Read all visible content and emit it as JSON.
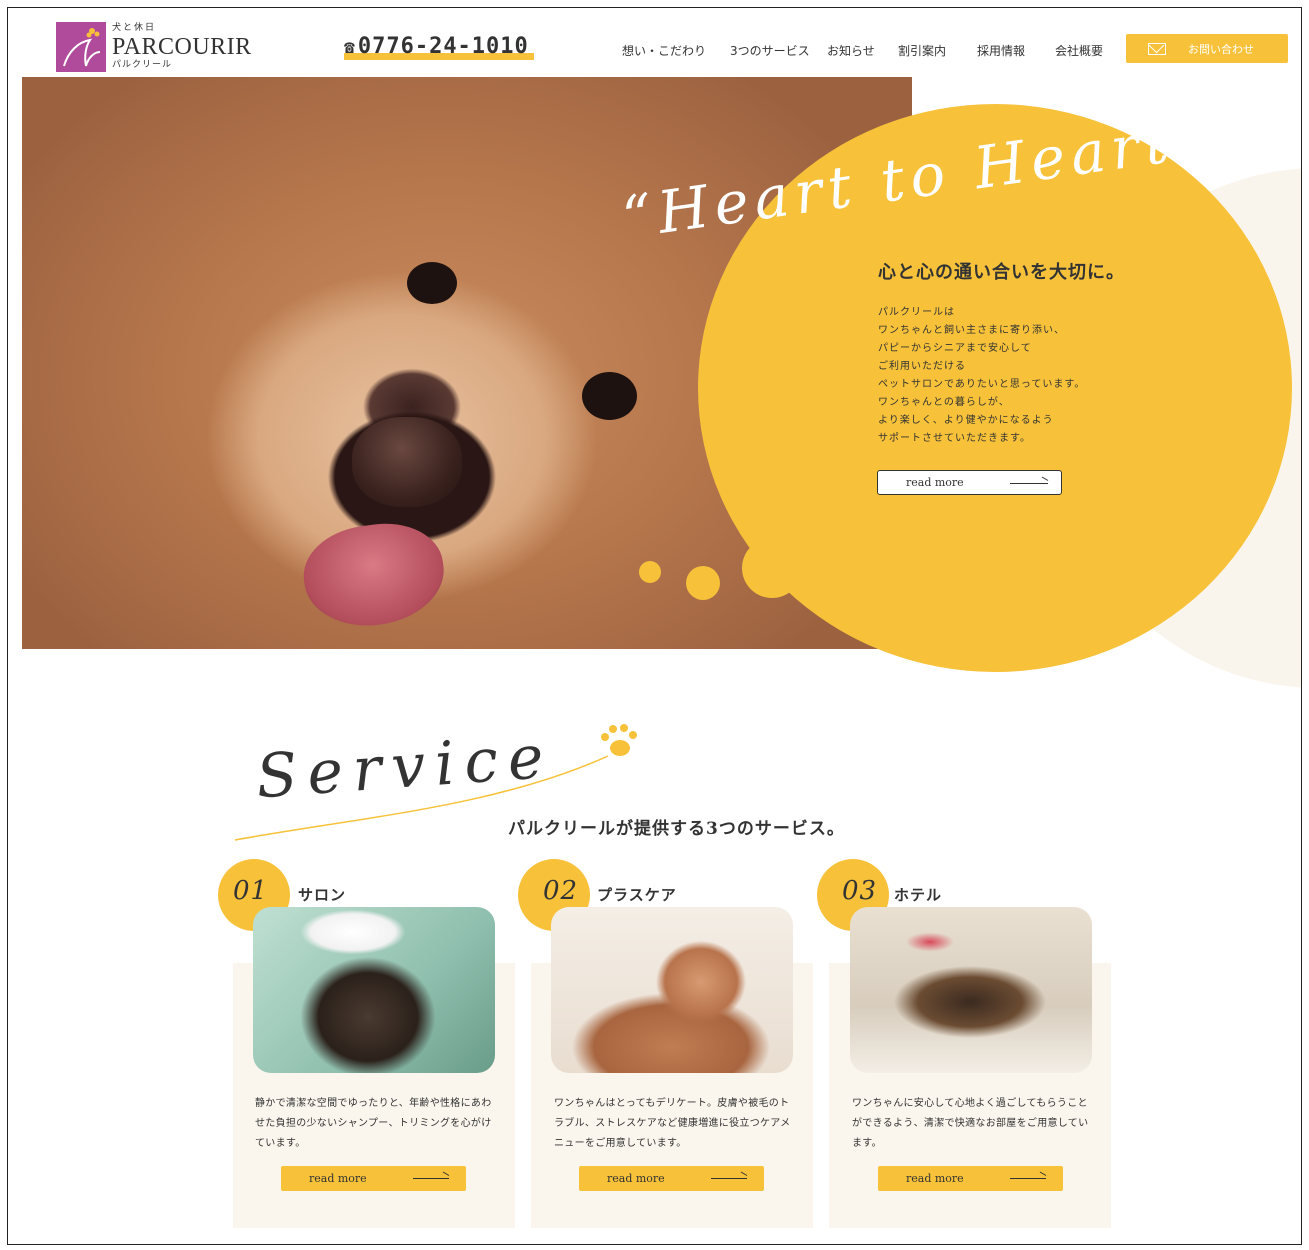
{
  "header": {
    "logo_tagline": "犬と休日",
    "logo_name": "PARCOURIR",
    "logo_kana": "パルクリール",
    "phone": "0776-24-1010",
    "nav": [
      "想い・こだわり",
      "3つのサービス",
      "お知らせ",
      "割引案内",
      "採用情報",
      "会社概要"
    ],
    "contact_label": "お問い合わせ"
  },
  "hero": {
    "script": "“Heart to Heart”",
    "title": "心と心の通い合いを大切に。",
    "body": "パルクリールは\nワンちゃんと飼い主さまに寄り添い、\nパピーからシニアまで安心して\nご利用いただける\nペットサロンでありたいと思っています。\nワンちゃんとの暮らしが、\nより楽しく、より健やかになるよう\nサポートさせていただきます。",
    "read_more": "read more"
  },
  "service": {
    "script": "Service",
    "subtitle": "パルクリールが提供する3つのサービス。",
    "cards": [
      {
        "num": "01",
        "title": "サロン",
        "text": "静かで清潔な空間でゆったりと、年齢や性格にあわせた負担の少ないシャンプー、トリミングを心がけています。",
        "read_more": "read more"
      },
      {
        "num": "02",
        "title": "プラスケア",
        "text": "ワンちゃんはとってもデリケート。皮膚や被毛のトラブル、ストレスケアなど健康増進に役立つケアメニューをご用意しています。",
        "read_more": "read more"
      },
      {
        "num": "03",
        "title": "ホテル",
        "text": "ワンちゃんに安心して心地よく過ごしてもらうことができるよう、清潔で快適なお部屋をご用意しています。",
        "read_more": "read more"
      }
    ]
  },
  "colors": {
    "accent": "#f7c23a",
    "brand": "#b04a9a",
    "cream": "#faf6ee"
  }
}
